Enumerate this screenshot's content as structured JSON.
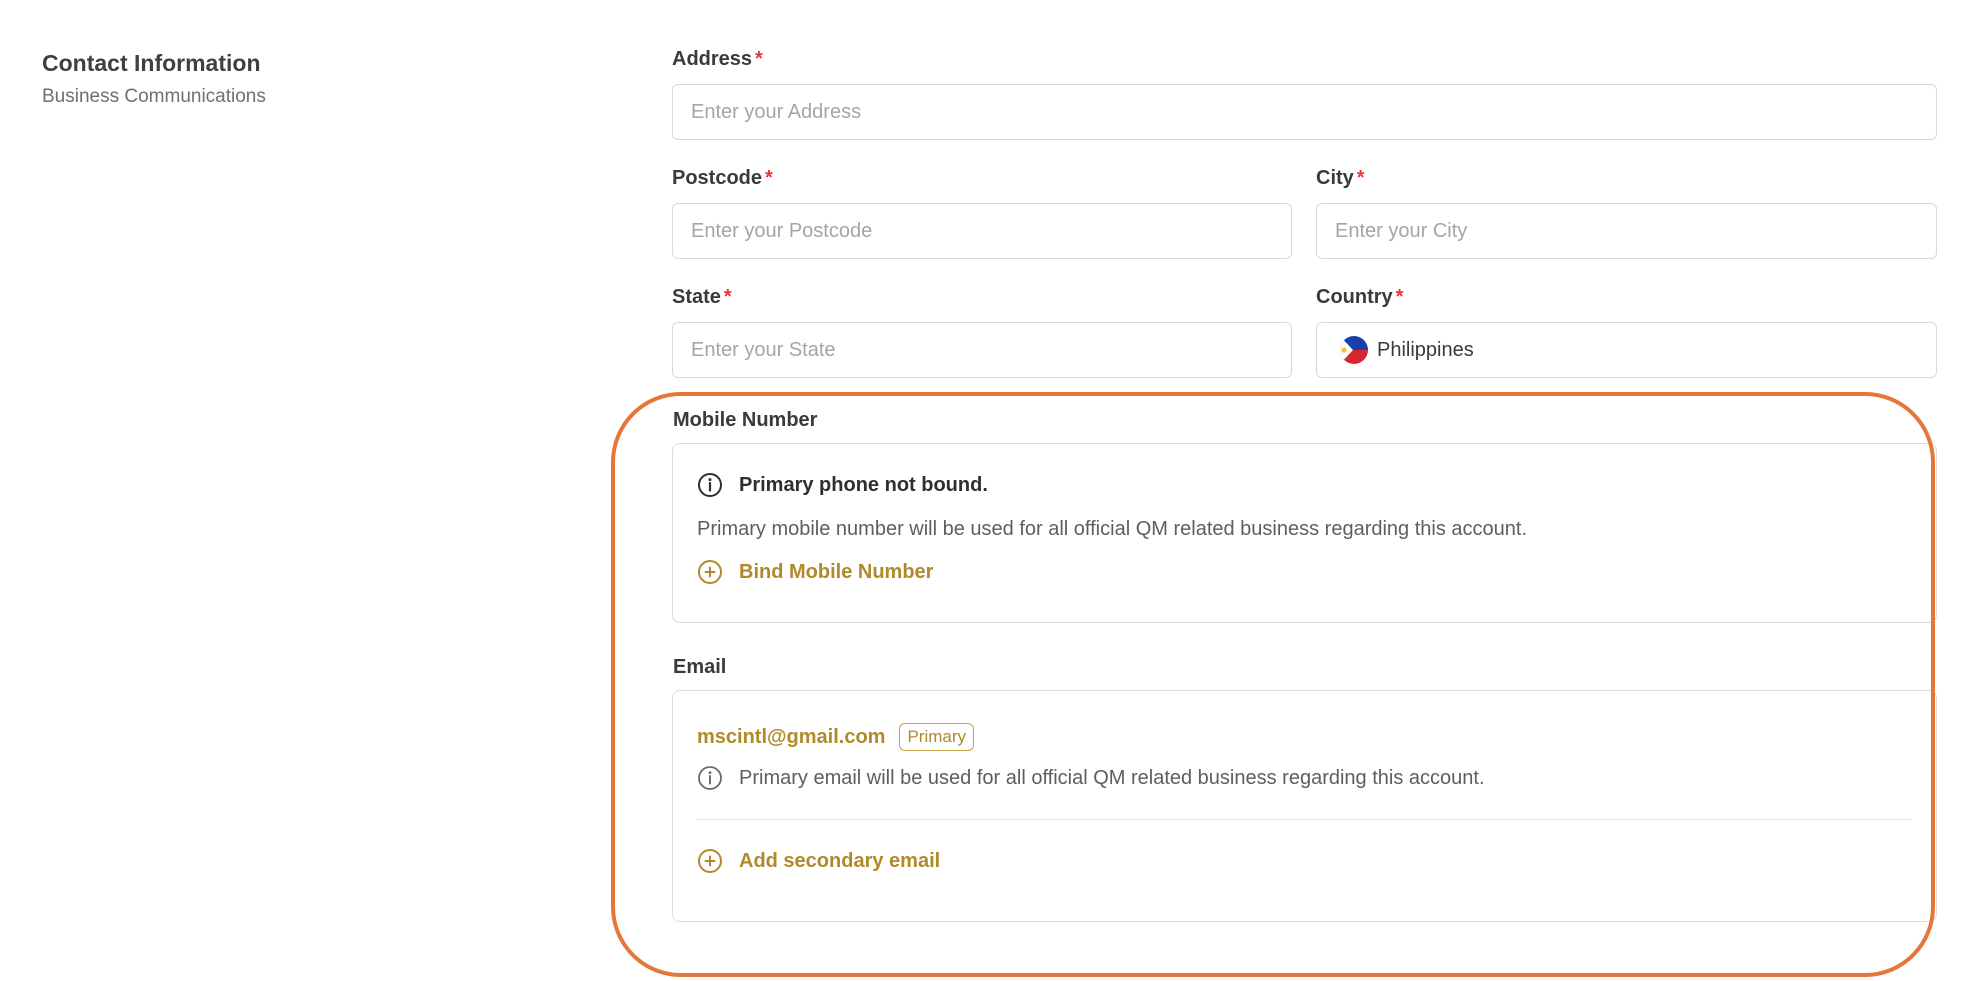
{
  "section": {
    "title": "Contact Information",
    "subtitle": "Business Communications"
  },
  "form": {
    "address": {
      "label": "Address",
      "required": "*",
      "placeholder": "Enter your Address"
    },
    "postcode": {
      "label": "Postcode",
      "required": "*",
      "placeholder": "Enter your Postcode"
    },
    "city": {
      "label": "City",
      "required": "*",
      "placeholder": "Enter your City"
    },
    "state": {
      "label": "State",
      "required": "*",
      "placeholder": "Enter your State"
    },
    "country": {
      "label": "Country",
      "required": "*",
      "value": "Philippines",
      "flag_icon": "philippines-flag-icon"
    }
  },
  "mobile": {
    "label": "Mobile Number",
    "notice_icon": "info-circle-icon",
    "notice_title": "Primary phone not bound.",
    "notice_text": "Primary mobile number will be used for all official QM related business regarding this account.",
    "action_icon": "plus-circle-icon",
    "action_label": "Bind Mobile Number"
  },
  "email": {
    "label": "Email",
    "address": "mscintl@gmail.com",
    "badge": "Primary",
    "info_icon": "info-circle-icon",
    "info_text": "Primary email will be used for all official QM related business regarding this account.",
    "action_icon": "plus-circle-icon",
    "action_label": "Add secondary email"
  },
  "colors": {
    "accent_gold": "#b08a2a",
    "required_red": "#e0393e",
    "highlight_orange": "#e5773b",
    "border": "#d9d9d9"
  }
}
